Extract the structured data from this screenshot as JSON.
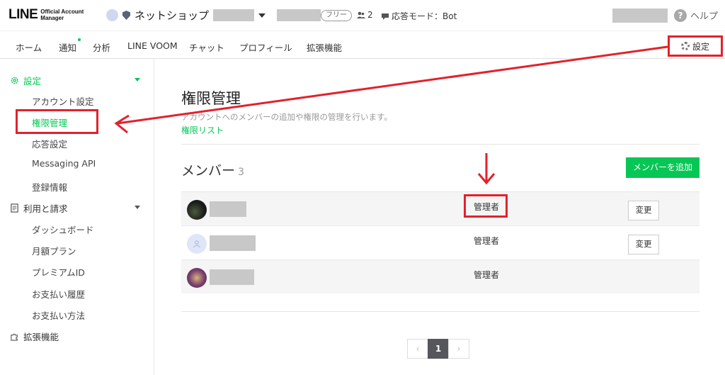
{
  "header": {
    "logo_main": "LINE",
    "logo_sub_1": "Official Account",
    "logo_sub_2": "Manager",
    "account_name": "ネットショップ",
    "plan_badge": "フリー",
    "member_count": "2",
    "response_mode": "応答モード：Bot",
    "help_label": "ヘルプ",
    "help_icon_glyph": "?"
  },
  "nav": {
    "items": [
      {
        "label": "ホーム"
      },
      {
        "label": "通知"
      },
      {
        "label": "分析"
      },
      {
        "label": "LINE VOOM"
      },
      {
        "label": "チャット"
      },
      {
        "label": "プロフィール"
      },
      {
        "label": "拡張機能"
      }
    ],
    "settings_label": "設定"
  },
  "sidebar": {
    "settings_section": "設定",
    "settings_items": [
      {
        "label": "アカウント設定"
      },
      {
        "label": "権限管理"
      },
      {
        "label": "応答設定"
      },
      {
        "label": "Messaging API"
      },
      {
        "label": "登録情報"
      }
    ],
    "billing_section": "利用と請求",
    "billing_items": [
      {
        "label": "ダッシュボード"
      },
      {
        "label": "月額プラン"
      },
      {
        "label": "プレミアムID"
      },
      {
        "label": "お支払い履歴"
      },
      {
        "label": "お支払い方法"
      }
    ],
    "extensions_section": "拡張機能"
  },
  "main": {
    "title": "権限管理",
    "description": "アカウントへのメンバーの追加や権限の管理を行います。",
    "link": "権限リスト",
    "members_heading": "メンバー",
    "members_count": "3",
    "add_button": "メンバーを追加",
    "members": [
      {
        "role": "管理者",
        "change": "変更"
      },
      {
        "role": "管理者",
        "change": "変更"
      },
      {
        "role": "管理者"
      }
    ],
    "pagination": {
      "prev": "‹",
      "current": "1",
      "next": "›"
    }
  },
  "colors": {
    "accent": "#06c755",
    "annotation": "#e1222c"
  }
}
